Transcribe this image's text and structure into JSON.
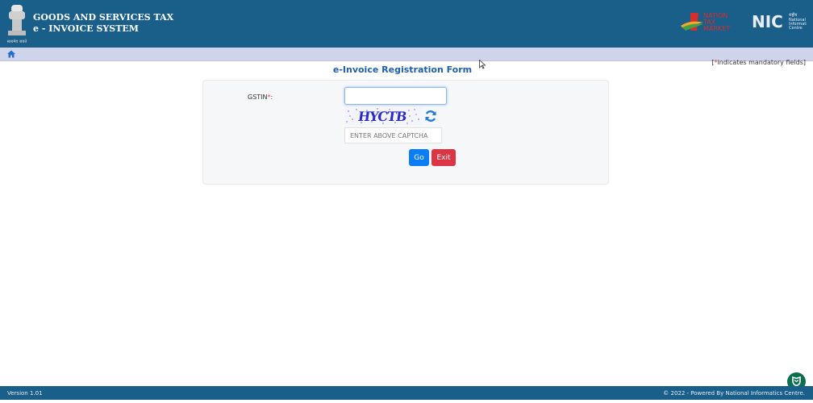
{
  "header": {
    "title_line1": "GOODS AND SERVICES TAX",
    "title_line2": "e - INVOICE SYSTEM",
    "emblem_caption": "सत्यमेव जयते",
    "partner_logo_1": "ONE NATION TAX MARKET",
    "partner_logo_2": "NIC National Informatics Centre"
  },
  "nav": {
    "home_icon": "home-icon"
  },
  "mandatory_note": {
    "open": "[",
    "star": "*",
    "text": "indicates mandatory fields]"
  },
  "form": {
    "title": "e-Invoice Registration Form",
    "gstin_label": "GSTIN",
    "gstin_star": "*",
    "gstin_colon": ":",
    "gstin_value": "",
    "captcha_text": "HYCTB",
    "captcha_placeholder": "ENTER ABOVE CAPTCHA",
    "captcha_value": "",
    "go_label": "Go",
    "exit_label": "Exit"
  },
  "footer": {
    "version": "Version 1.01",
    "copyright": "© 2022 - Powered By National Informatics Centre."
  },
  "colors": {
    "header_bg": "#1a5e8a",
    "nav_bg": "#cfd4ea",
    "title": "#1f5fa8",
    "go": "#0a7df7",
    "exit": "#dc3545",
    "mandatory_star": "#e53935"
  }
}
